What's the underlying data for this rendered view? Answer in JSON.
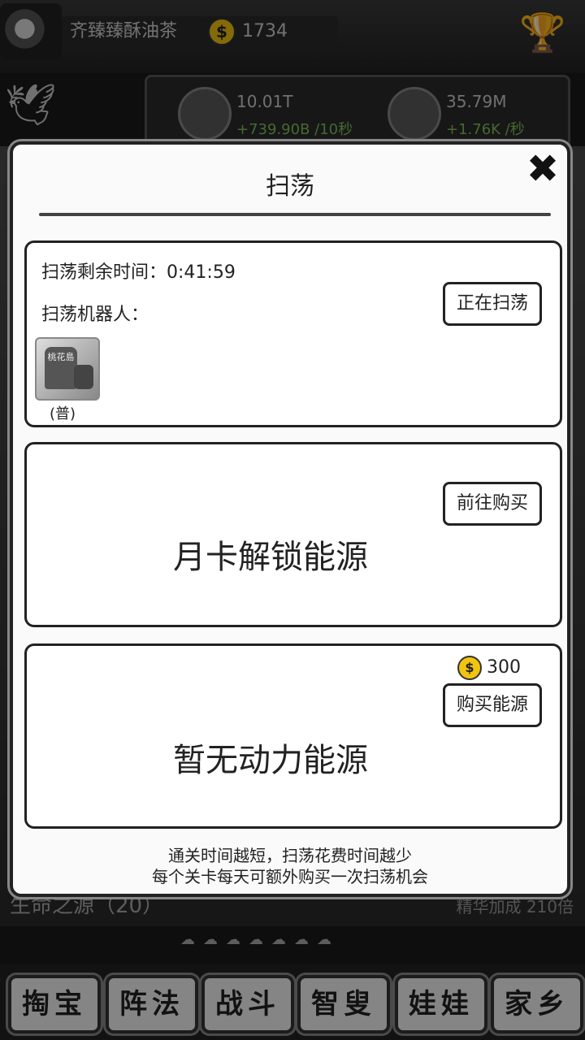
{
  "header": {
    "player_name": "齐臻臻酥油茶",
    "coins": "1734",
    "coin_symbol": "$"
  },
  "resources": [
    {
      "value": "10.01T",
      "rate": "+739.90B /10秒",
      "icon": "tadpole-icon"
    },
    {
      "value": "35.79M",
      "rate": "+1.76K /秒",
      "icon": "crystal-icon"
    }
  ],
  "background": {
    "life_source": "生命之源（20）",
    "bonus": "精华加成 210倍"
  },
  "nav": [
    {
      "label": "掏宝"
    },
    {
      "label": "阵法"
    },
    {
      "label": "战斗"
    },
    {
      "label": "智叟"
    },
    {
      "label": "娃娃"
    },
    {
      "label": "家乡"
    }
  ],
  "dialog": {
    "title": "扫荡",
    "close_symbol": "✖",
    "sweep": {
      "remaining_label": "扫荡剩余时间：0:41:59",
      "robot_label": "扫荡机器人：",
      "robot_grade": "(普)",
      "robot_name": "桃花島",
      "status_button": "正在扫荡"
    },
    "month_card": {
      "text": "月卡解锁能源",
      "button": "前往购买"
    },
    "energy": {
      "text": "暂无动力能源",
      "price": "300",
      "button": "购买能源"
    },
    "note_line1": "通关时间越短，扫荡花费时间越少",
    "note_line2": "每个关卡每天可额外购买一次扫荡机会"
  }
}
